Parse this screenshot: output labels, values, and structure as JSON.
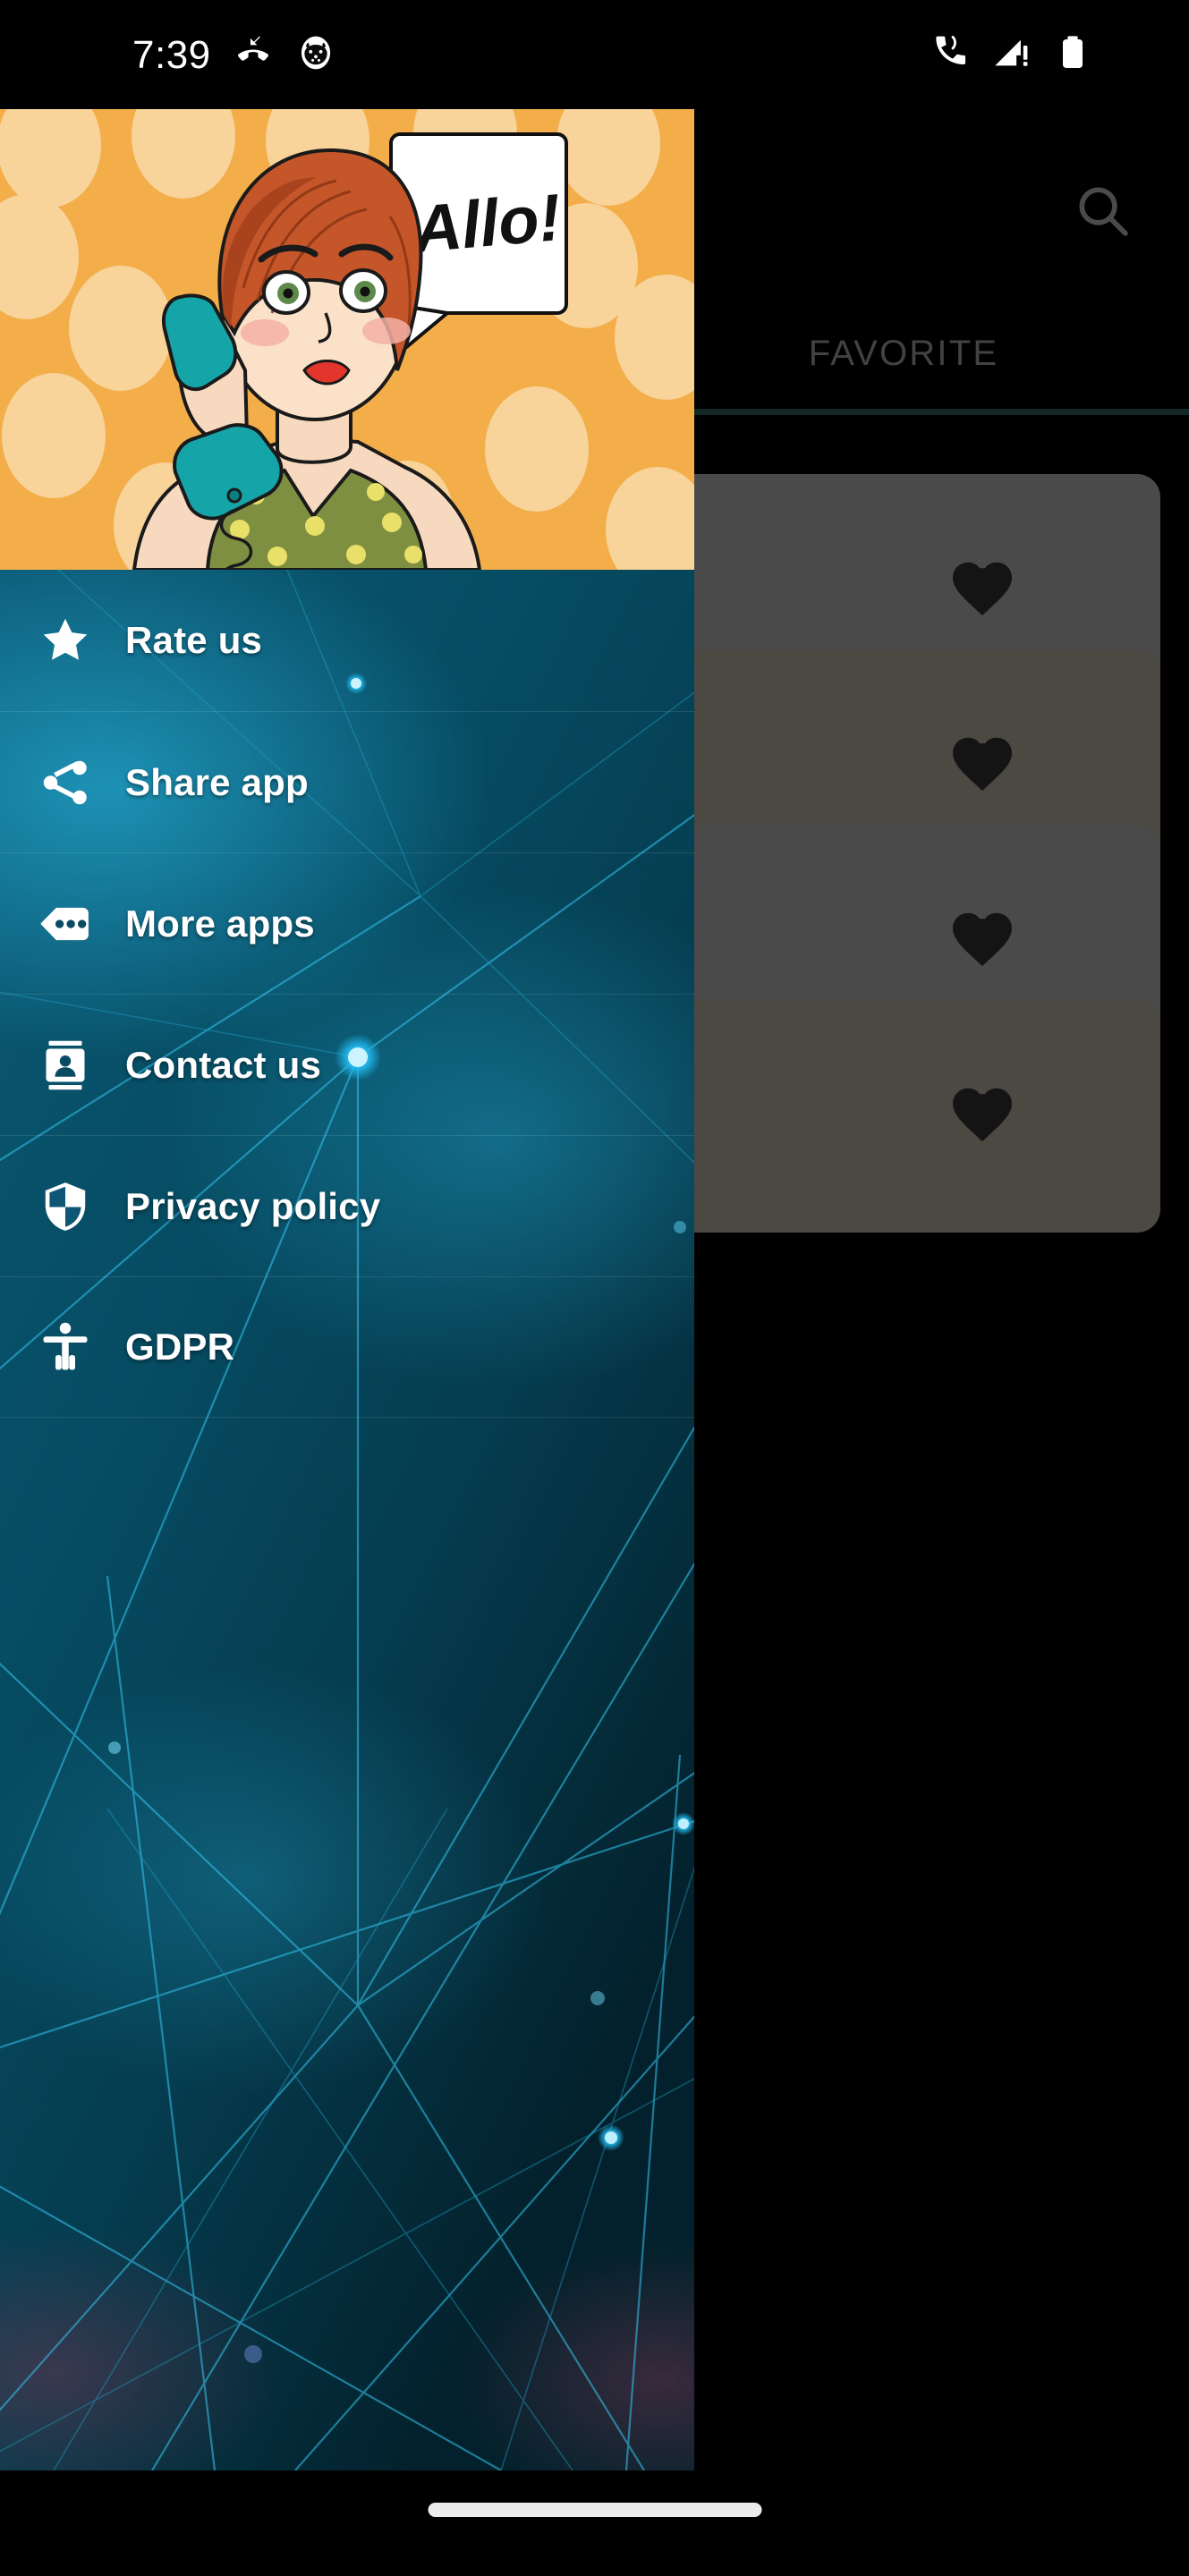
{
  "status_bar": {
    "time": "7:39",
    "left_icons": [
      "missed-call-icon",
      "app-notification-icon"
    ],
    "right_icons": [
      "ringer-vibrate-call-icon",
      "cellular-no-sim-icon",
      "battery-full-icon"
    ]
  },
  "app": {
    "search_icon": "search-icon",
    "tabs": [
      {
        "label": "FAVORITE",
        "selected": true
      }
    ],
    "tab_indicator_color": "#1e3a39",
    "cards": [
      {
        "name": "favorite-card",
        "favorite_icon": "heart-icon",
        "bg": "#6a6a6a"
      },
      {
        "name": "favorite-card",
        "favorite_icon": "heart-icon",
        "bg": "#6e675f"
      },
      {
        "name": "favorite-card",
        "favorite_icon": "heart-icon",
        "bg": "#6a6a6a"
      },
      {
        "name": "favorite-card",
        "favorite_icon": "heart-icon",
        "bg": "#6e675f"
      }
    ]
  },
  "drawer": {
    "header": {
      "speech_bubble_text": "Allo!",
      "background_color": "#f0ab45",
      "illustration": "pop-art-woman-on-telephone"
    },
    "background_color": "#0a4a63",
    "items": [
      {
        "label": "Rate us",
        "icon": "star-icon"
      },
      {
        "label": "Share app",
        "icon": "share-icon"
      },
      {
        "label": "More apps",
        "icon": "more-apps-icon"
      },
      {
        "label": "Contact us",
        "icon": "contact-card-icon"
      },
      {
        "label": "Privacy policy",
        "icon": "shield-icon"
      },
      {
        "label": "GDPR",
        "icon": "accessibility-icon"
      }
    ]
  },
  "navigation_bar": {
    "gesture_pill": "home-gesture-pill"
  }
}
